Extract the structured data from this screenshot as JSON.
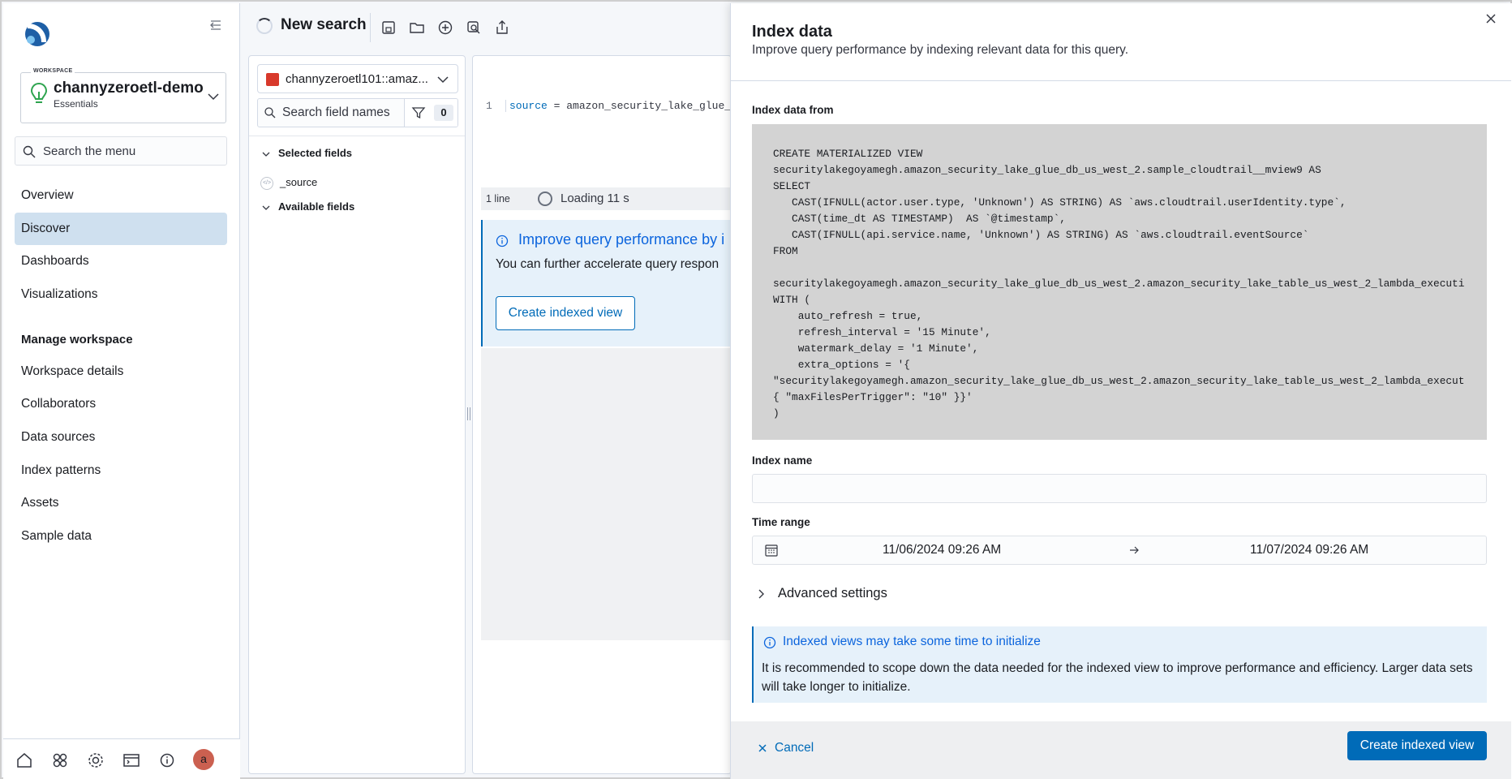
{
  "colors": {
    "primary": "#006bb8",
    "active_nav": "#cfe0ef",
    "callout_bg": "#e6f1fa",
    "code_bg": "#d3d3d3",
    "avatar": "#cb6050"
  },
  "leftnav": {
    "workspace_caption": "WORKSPACE",
    "workspace_name": "channyzeroetl-demo",
    "workspace_plan": "Essentials",
    "search_placeholder": "Search the menu",
    "items": [
      {
        "label": "Overview",
        "active": false
      },
      {
        "label": "Discover",
        "active": true
      },
      {
        "label": "Dashboards",
        "active": false
      },
      {
        "label": "Visualizations",
        "active": false
      }
    ],
    "manage_heading": "Manage workspace",
    "manage_items": [
      {
        "label": "Workspace details"
      },
      {
        "label": "Collaborators"
      },
      {
        "label": "Data sources"
      },
      {
        "label": "Index patterns"
      },
      {
        "label": "Assets"
      },
      {
        "label": "Sample data"
      }
    ],
    "bottom_icons": [
      "home-icon",
      "apps-icon",
      "settings-icon",
      "dev-tools-icon",
      "help-icon"
    ],
    "avatar_initial": "a"
  },
  "toolbar": {
    "title": "New search",
    "icons": [
      "save-icon",
      "open-icon",
      "new-icon",
      "inspect-icon",
      "share-icon"
    ]
  },
  "fields": {
    "datasource": "channyzeroetl101::amaz...",
    "search_placeholder": "Search field names",
    "filter_count": "0",
    "selected_heading": "Selected fields",
    "selected": [
      "_source"
    ],
    "available_heading": "Available fields"
  },
  "query": {
    "line_number": "1",
    "keyword": "source",
    "rest": " = amazon_security_lake_glue_",
    "lines_label": "1 line",
    "loading_label": "Loading 11 s",
    "callout_title": "Improve query performance by i",
    "callout_body": "You can further accelerate query respon",
    "callout_button": "Create indexed view"
  },
  "flyout": {
    "title": "Index data",
    "subtitle": "Improve query performance by indexing relevant data for this query.",
    "index_from_label": "Index data from",
    "sql": "CREATE MATERIALIZED VIEW\nsecuritylakegoyamegh.amazon_security_lake_glue_db_us_west_2.sample_cloudtrail__mview9 AS\nSELECT\n   CAST(IFNULL(actor.user.type, 'Unknown') AS STRING) AS `aws.cloudtrail.userIdentity.type`,\n   CAST(time_dt AS TIMESTAMP)  AS `@timestamp`,\n   CAST(IFNULL(api.service.name, 'Unknown') AS STRING) AS `aws.cloudtrail.eventSource`\nFROM\n\nsecuritylakegoyamegh.amazon_security_lake_glue_db_us_west_2.amazon_security_lake_table_us_west_2_lambda_executi\nWITH (\n    auto_refresh = true,\n    refresh_interval = '15 Minute',\n    watermark_delay = '1 Minute',\n    extra_options = '{\n\"securitylakegoyamegh.amazon_security_lake_glue_db_us_west_2.amazon_security_lake_table_us_west_2_lambda_execut\n{ \"maxFilesPerTrigger\": \"10\" }}'\n)",
    "index_name_label": "Index name",
    "index_name_value": "",
    "time_range_label": "Time range",
    "time_start": "11/06/2024 09:26 AM",
    "time_end": "11/07/2024 09:26 AM",
    "advanced_label": "Advanced settings",
    "info_title": "Indexed views may take some time to initialize",
    "info_body": "It is recommended to scope down the data needed for the indexed view to improve performance and efficiency. Larger data sets will take longer to initialize.",
    "cancel_label": "Cancel",
    "submit_label": "Create indexed view"
  }
}
